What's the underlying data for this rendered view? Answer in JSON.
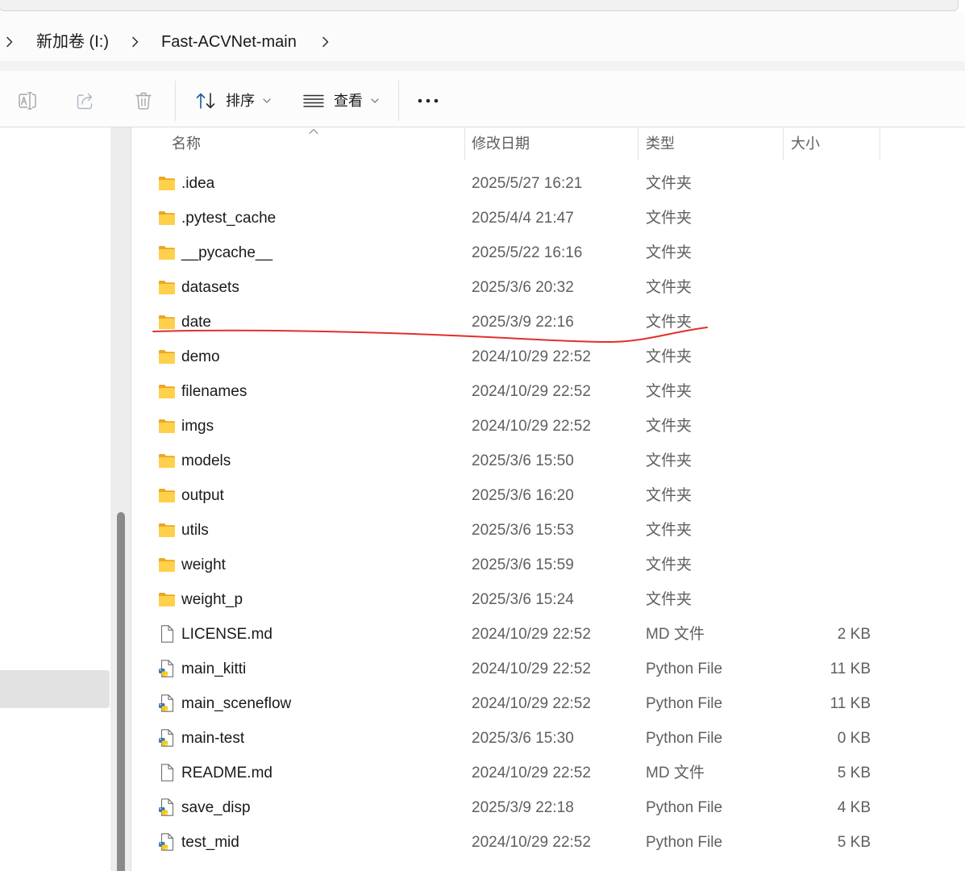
{
  "breadcrumb": {
    "items": [
      "新加卷 (I:)",
      "Fast-ACVNet-main"
    ],
    "separator_icon": "chevron-right-icon"
  },
  "toolbar": {
    "rename_icon": "rename-icon",
    "share_icon": "share-icon",
    "delete_icon": "delete-icon",
    "sort": {
      "icon": "sort-icon",
      "label": "排序",
      "dropdown_icon": "chevron-down-icon"
    },
    "view": {
      "icon": "view-list-icon",
      "label": "查看",
      "dropdown_icon": "chevron-down-icon"
    },
    "more_icon": "more-icon"
  },
  "columns": {
    "name": "名称",
    "modified": "修改日期",
    "type": "类型",
    "size": "大小",
    "sort_indicator_icon": "chevron-up-icon"
  },
  "colors": {
    "folder": "#ffd04a",
    "folder_back": "#e9a723",
    "python_blue": "#3a75b0",
    "python_yellow": "#f7c918",
    "annotation": "#e0302b",
    "selection": "#e2e2e2"
  },
  "files": [
    {
      "name": ".idea",
      "modified": "2025/5/27 16:21",
      "type": "文件夹",
      "icon": "folder-icon"
    },
    {
      "name": ".pytest_cache",
      "modified": "2025/4/4 21:47",
      "type": "文件夹",
      "icon": "folder-icon"
    },
    {
      "name": "__pycache__",
      "modified": "2025/5/22 16:16",
      "type": "文件夹",
      "icon": "folder-icon"
    },
    {
      "name": "datasets",
      "modified": "2025/3/6 20:32",
      "type": "文件夹",
      "icon": "folder-icon"
    },
    {
      "name": "date",
      "modified": "2025/3/9 22:16",
      "type": "文件夹",
      "icon": "folder-icon"
    },
    {
      "name": "demo",
      "modified": "2024/10/29 22:52",
      "type": "文件夹",
      "icon": "folder-icon"
    },
    {
      "name": "filenames",
      "modified": "2024/10/29 22:52",
      "type": "文件夹",
      "icon": "folder-icon"
    },
    {
      "name": "imgs",
      "modified": "2024/10/29 22:52",
      "type": "文件夹",
      "icon": "folder-icon"
    },
    {
      "name": "models",
      "modified": "2025/3/6 15:50",
      "type": "文件夹",
      "icon": "folder-icon"
    },
    {
      "name": "output",
      "modified": "2025/3/6 16:20",
      "type": "文件夹",
      "icon": "folder-icon"
    },
    {
      "name": "utils",
      "modified": "2025/3/6 15:53",
      "type": "文件夹",
      "icon": "folder-icon"
    },
    {
      "name": "weight",
      "modified": "2025/3/6 15:59",
      "type": "文件夹",
      "icon": "folder-icon"
    },
    {
      "name": "weight_p",
      "modified": "2025/3/6 15:24",
      "type": "文件夹",
      "icon": "folder-icon"
    },
    {
      "name": "LICENSE.md",
      "modified": "2024/10/29 22:52",
      "type": "MD 文件",
      "size": "2 KB",
      "icon": "document-icon"
    },
    {
      "name": "main_kitti",
      "modified": "2024/10/29 22:52",
      "type": "Python File",
      "size": "11 KB",
      "icon": "python-file-icon"
    },
    {
      "name": "main_sceneflow",
      "modified": "2024/10/29 22:52",
      "type": "Python File",
      "size": "11 KB",
      "icon": "python-file-icon"
    },
    {
      "name": "main-test",
      "modified": "2025/3/6 15:30",
      "type": "Python File",
      "size": "0 KB",
      "icon": "python-file-icon"
    },
    {
      "name": "README.md",
      "modified": "2024/10/29 22:52",
      "type": "MD 文件",
      "size": "5 KB",
      "icon": "document-icon"
    },
    {
      "name": "save_disp",
      "modified": "2025/3/9 22:18",
      "type": "Python File",
      "size": "4 KB",
      "icon": "python-file-icon"
    },
    {
      "name": "test_mid",
      "modified": "2024/10/29 22:52",
      "type": "Python File",
      "size": "5 KB",
      "icon": "python-file-icon"
    }
  ]
}
